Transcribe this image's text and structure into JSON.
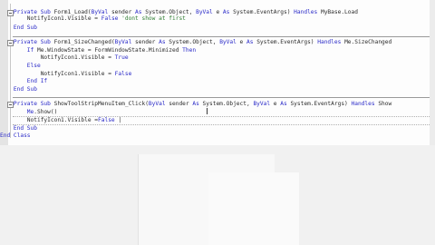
{
  "editor": {
    "lines": [
      {
        "segments": [
          {
            "t": "    Private Sub ",
            "c": "kw"
          },
          {
            "t": "Form1_Load(",
            "c": ""
          },
          {
            "t": "ByVal ",
            "c": "kw"
          },
          {
            "t": "sender ",
            "c": ""
          },
          {
            "t": "As ",
            "c": "kw"
          },
          {
            "t": "System.Object, ",
            "c": ""
          },
          {
            "t": "ByVal ",
            "c": "kw"
          },
          {
            "t": "e ",
            "c": ""
          },
          {
            "t": "As ",
            "c": "kw"
          },
          {
            "t": "System.EventArgs) ",
            "c": ""
          },
          {
            "t": "Handles ",
            "c": "kw"
          },
          {
            "t": "MyBase.Load",
            "c": ""
          }
        ]
      },
      {
        "segments": [
          {
            "t": "        NotifyIcon1.Visible = ",
            "c": ""
          },
          {
            "t": "False ",
            "c": "kw"
          },
          {
            "t": "'dont show at first",
            "c": "cm"
          }
        ]
      },
      {
        "segments": [
          {
            "t": "    End Sub",
            "c": "kw"
          }
        ]
      },
      {
        "segments": [
          {
            "t": "    Private Sub ",
            "c": "kw"
          },
          {
            "t": "Form1_SizeChanged(",
            "c": ""
          },
          {
            "t": "ByVal ",
            "c": "kw"
          },
          {
            "t": "sender ",
            "c": ""
          },
          {
            "t": "As ",
            "c": "kw"
          },
          {
            "t": "System.Object, ",
            "c": ""
          },
          {
            "t": "ByVal ",
            "c": "kw"
          },
          {
            "t": "e ",
            "c": ""
          },
          {
            "t": "As ",
            "c": "kw"
          },
          {
            "t": "System.EventArgs) ",
            "c": ""
          },
          {
            "t": "Handles ",
            "c": "kw"
          },
          {
            "t": "Me.SizeChanged",
            "c": ""
          }
        ]
      },
      {
        "segments": [
          {
            "t": "        If ",
            "c": "kw"
          },
          {
            "t": "Me.WindowState = FormWindowState.Minimized ",
            "c": ""
          },
          {
            "t": "Then",
            "c": "kw"
          }
        ]
      },
      {
        "segments": [
          {
            "t": "            NotifyIcon1.Visible = ",
            "c": ""
          },
          {
            "t": "True",
            "c": "kw"
          }
        ]
      },
      {
        "segments": [
          {
            "t": "        Else",
            "c": "kw"
          }
        ]
      },
      {
        "segments": [
          {
            "t": "            NotifyIcon1.Visible = ",
            "c": ""
          },
          {
            "t": "False",
            "c": "kw"
          }
        ]
      },
      {
        "segments": [
          {
            "t": "        End If",
            "c": "kw"
          }
        ]
      },
      {
        "segments": [
          {
            "t": "    End Sub",
            "c": "kw"
          }
        ]
      },
      {
        "segments": [
          {
            "t": "    Private Sub ",
            "c": "kw"
          },
          {
            "t": "ShowToolStripMenuItem_Click(",
            "c": ""
          },
          {
            "t": "ByVal ",
            "c": "kw"
          },
          {
            "t": "sender ",
            "c": ""
          },
          {
            "t": "As ",
            "c": "kw"
          },
          {
            "t": "System.Object, ",
            "c": ""
          },
          {
            "t": "ByVal ",
            "c": "kw"
          },
          {
            "t": "e ",
            "c": ""
          },
          {
            "t": "As ",
            "c": "kw"
          },
          {
            "t": "System.EventArgs) ",
            "c": ""
          },
          {
            "t": "Handles ",
            "c": "kw"
          },
          {
            "t": "Show",
            "c": ""
          }
        ]
      },
      {
        "segments": [
          {
            "t": "        Me",
            "c": "kw"
          },
          {
            "t": ".Show()",
            "c": ""
          }
        ]
      },
      {
        "segments": [
          {
            "t": "        NotifyIcon1.Visible =",
            "c": ""
          },
          {
            "t": "False",
            "c": "kw"
          },
          {
            "t": " |",
            "c": ""
          }
        ]
      },
      {
        "segments": [
          {
            "t": "    End Sub",
            "c": "kw"
          }
        ]
      },
      {
        "segments": [
          {
            "t": "End Class",
            "c": "kw"
          }
        ]
      }
    ]
  },
  "cursor_glyph": "I",
  "colors": {
    "keyword": "#2a2ac8",
    "comment": "#2f7d32",
    "text": "#2b2b2b",
    "background": "#fdfdfd"
  }
}
